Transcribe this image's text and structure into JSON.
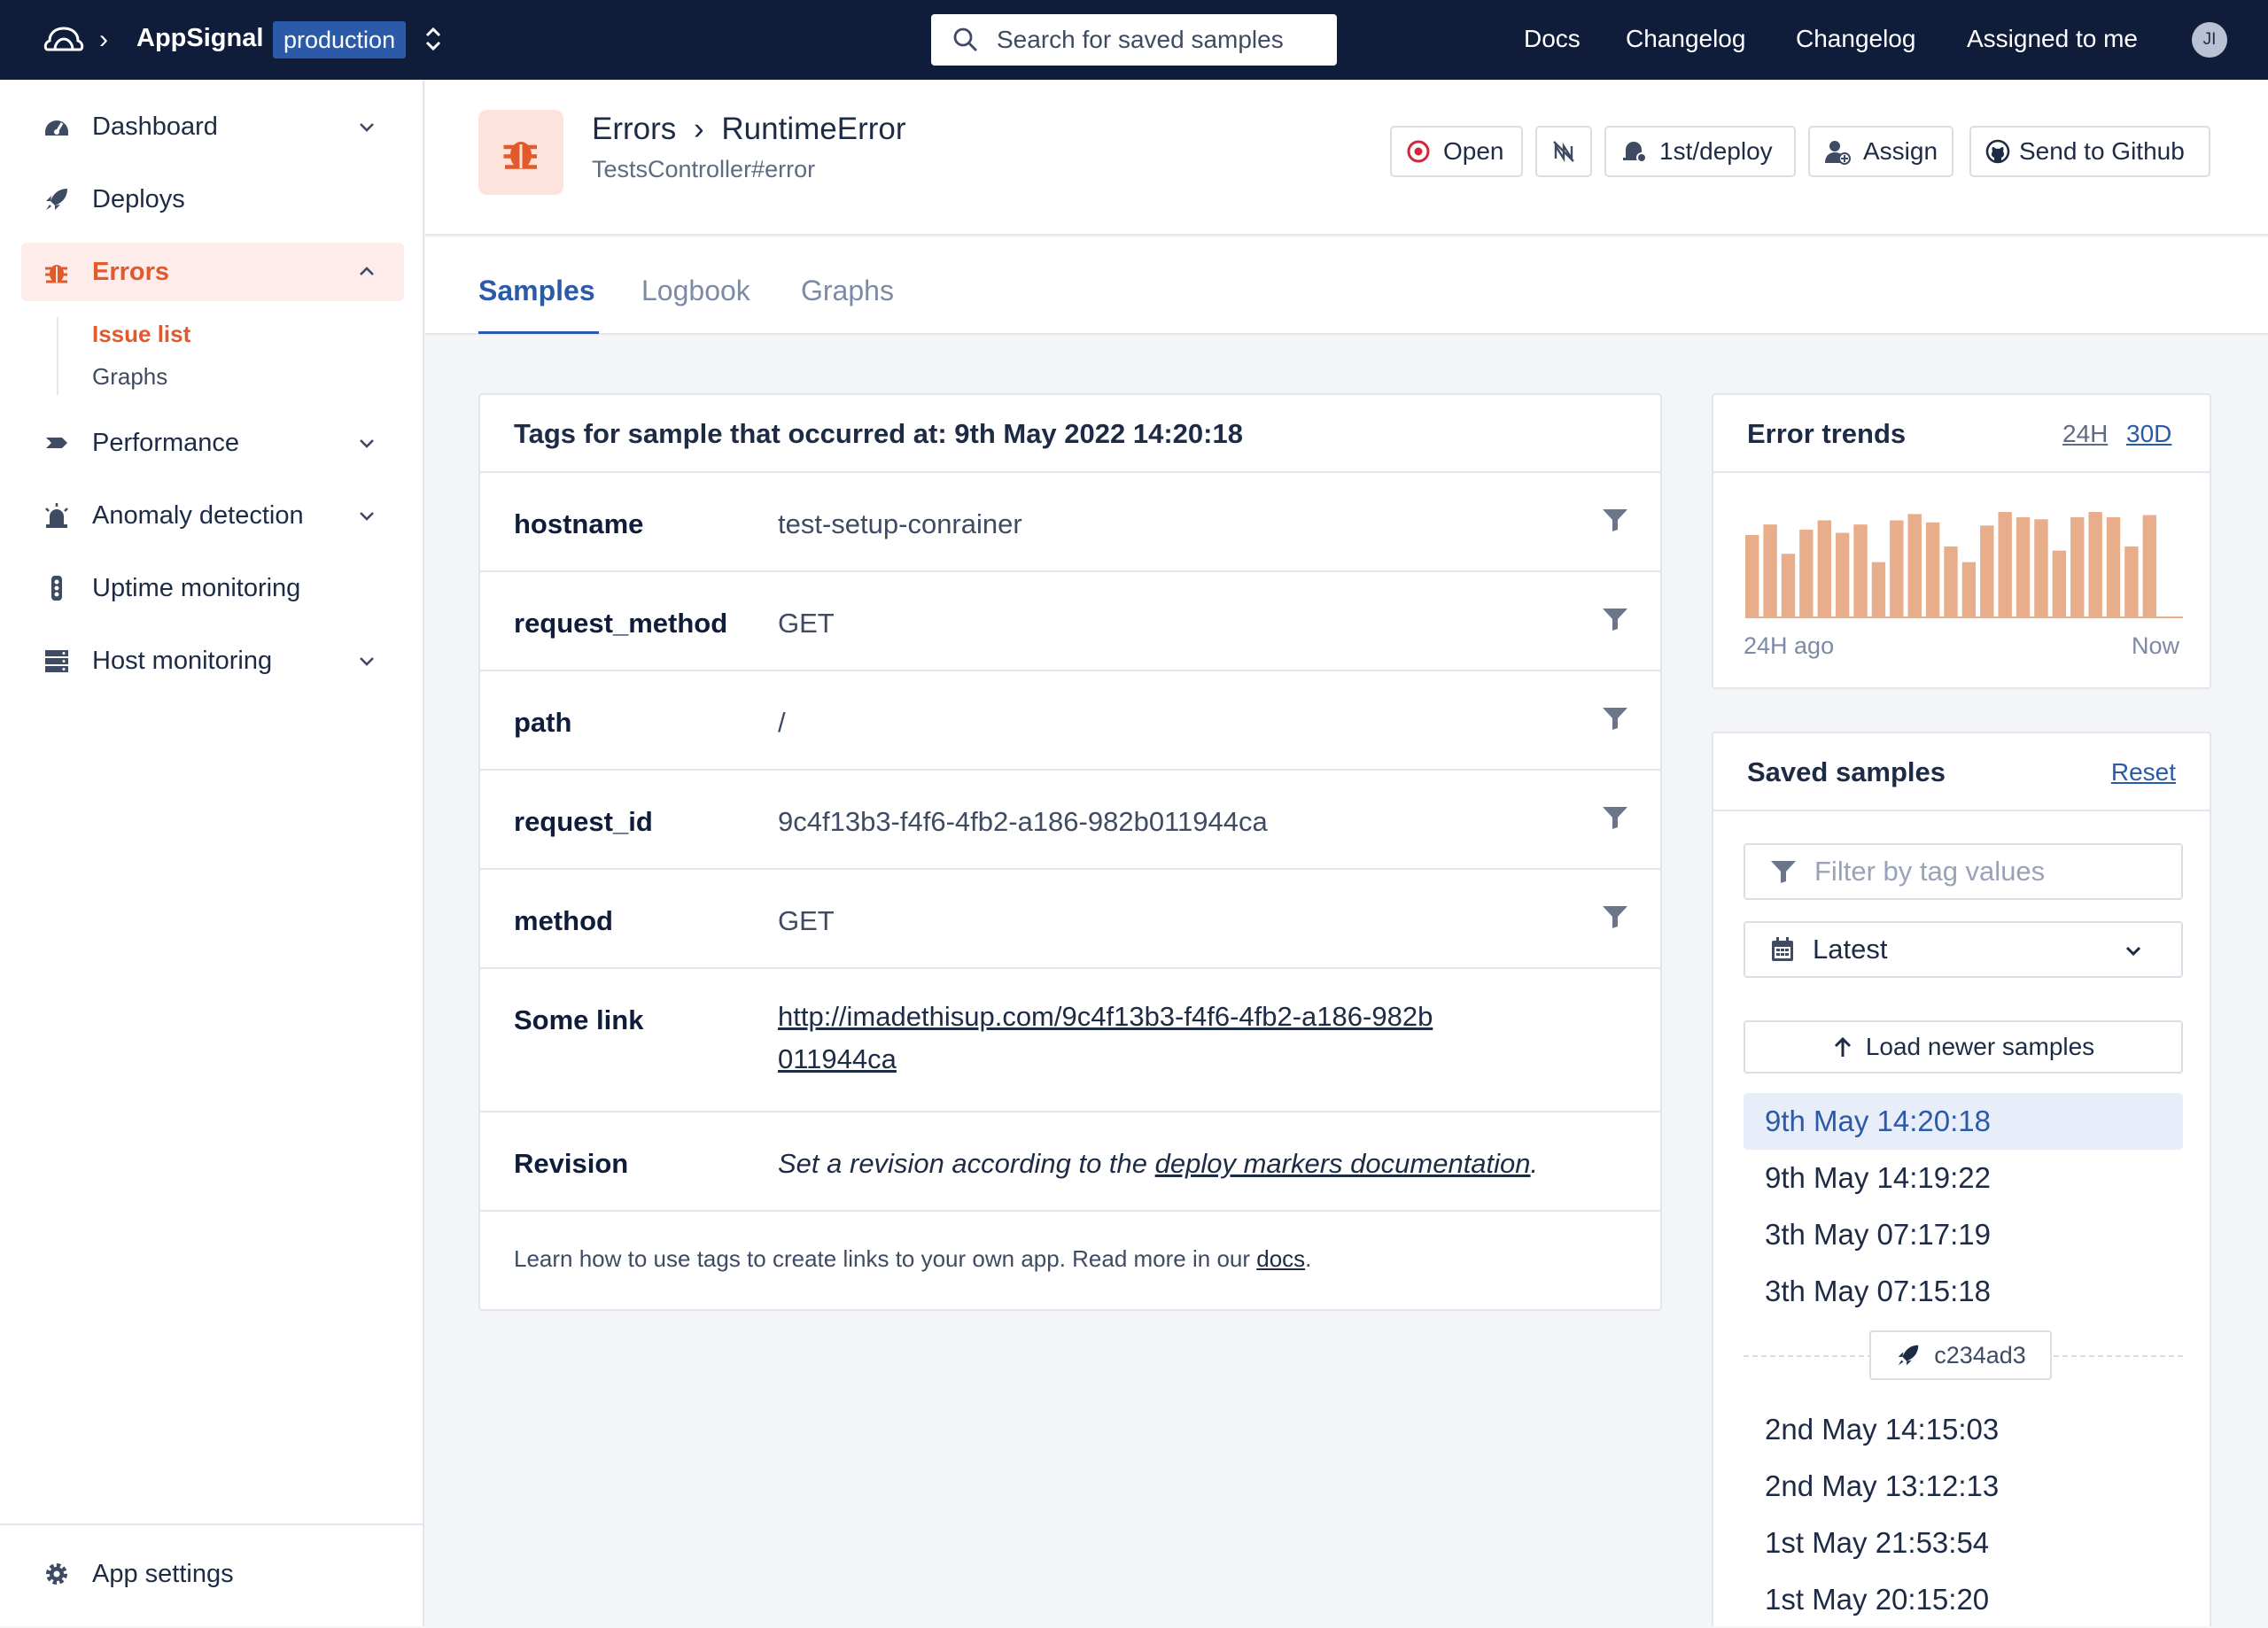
{
  "topbar": {
    "app_name": "AppSignal",
    "environment": "production",
    "search_placeholder": "Search for saved samples",
    "links": [
      "Docs",
      "Changelog",
      "Changelog",
      "Assigned to me"
    ],
    "avatar_initials": "JI"
  },
  "sidebar": {
    "items": [
      {
        "label": "Dashboard",
        "icon": "dashboard-icon"
      },
      {
        "label": "Deploys",
        "icon": "rocket-icon"
      },
      {
        "label": "Errors",
        "icon": "bug-icon"
      },
      {
        "label": "Performance",
        "icon": "performance-icon"
      },
      {
        "label": "Anomaly detection",
        "icon": "alarm-icon"
      },
      {
        "label": "Uptime monitoring",
        "icon": "traffic-light-icon"
      },
      {
        "label": "Host monitoring",
        "icon": "server-icon"
      }
    ],
    "errors_sub": [
      "Issue list",
      "Graphs"
    ],
    "settings_label": "App settings"
  },
  "header": {
    "section": "Errors",
    "error_name": "RuntimeError",
    "action": "TestsController#error",
    "buttons": {
      "open": "Open",
      "notify": "1st/deploy",
      "assign": "Assign",
      "github": "Send to Github"
    }
  },
  "tabs": [
    "Samples",
    "Logbook",
    "Graphs"
  ],
  "tags_panel": {
    "title": "Tags for sample that occurred at: 9th May 2022 14:20:18",
    "rows": [
      {
        "key": "hostname",
        "value": "test-setup-conrainer"
      },
      {
        "key": "request_method",
        "value": "GET"
      },
      {
        "key": "path",
        "value": "/"
      },
      {
        "key": "request_id",
        "value": "9c4f13b3-f4f6-4fb2-a186-982b011944ca"
      },
      {
        "key": "method",
        "value": "GET"
      },
      {
        "key": "Some link",
        "value": "http://imadethisup.com/9c4f13b3-f4f6-4fb2-a186-982b011944ca"
      },
      {
        "key": "Revision",
        "value_prefix": "Set a revision according to the ",
        "value_link": "deploy markers documentation",
        "value_suffix": "."
      }
    ],
    "footer_text": "Learn how to use tags to create links to your own app. Read more in our ",
    "footer_link": "docs",
    "footer_end": "."
  },
  "trends": {
    "title": "Error trends",
    "ranges": [
      "24H",
      "30D"
    ],
    "selected_range": "24H",
    "start_label": "24H ago",
    "end_label": "Now",
    "bar_color": "#e8ad8a",
    "values": [
      0.78,
      0.88,
      0.6,
      0.83,
      0.92,
      0.8,
      0.88,
      0.52,
      0.92,
      0.98,
      0.9,
      0.67,
      0.52,
      0.87,
      1.0,
      0.95,
      0.93,
      0.63,
      0.95,
      1.0,
      0.95,
      0.67,
      0.97
    ]
  },
  "saved_samples": {
    "title": "Saved samples",
    "reset": "Reset",
    "filter_placeholder": "Filter by tag values",
    "sort_value": "Latest",
    "load_newer": "Load newer samples",
    "samples_before_deploy": [
      "9th May 14:20:18",
      "9th May 14:19:22",
      "3th May 07:17:19",
      "3th May 07:15:18"
    ],
    "deploy_revision": "c234ad3",
    "samples_after_deploy": [
      "2nd May 14:15:03",
      "2nd May 13:12:13",
      "1st May 21:53:54",
      "1st May 20:15:20"
    ],
    "selected_sample": "9th May 14:20:18"
  },
  "colors": {
    "nav": "#0f1d3a",
    "accent": "#2a5aa8",
    "error_accent": "#e05a2b"
  }
}
